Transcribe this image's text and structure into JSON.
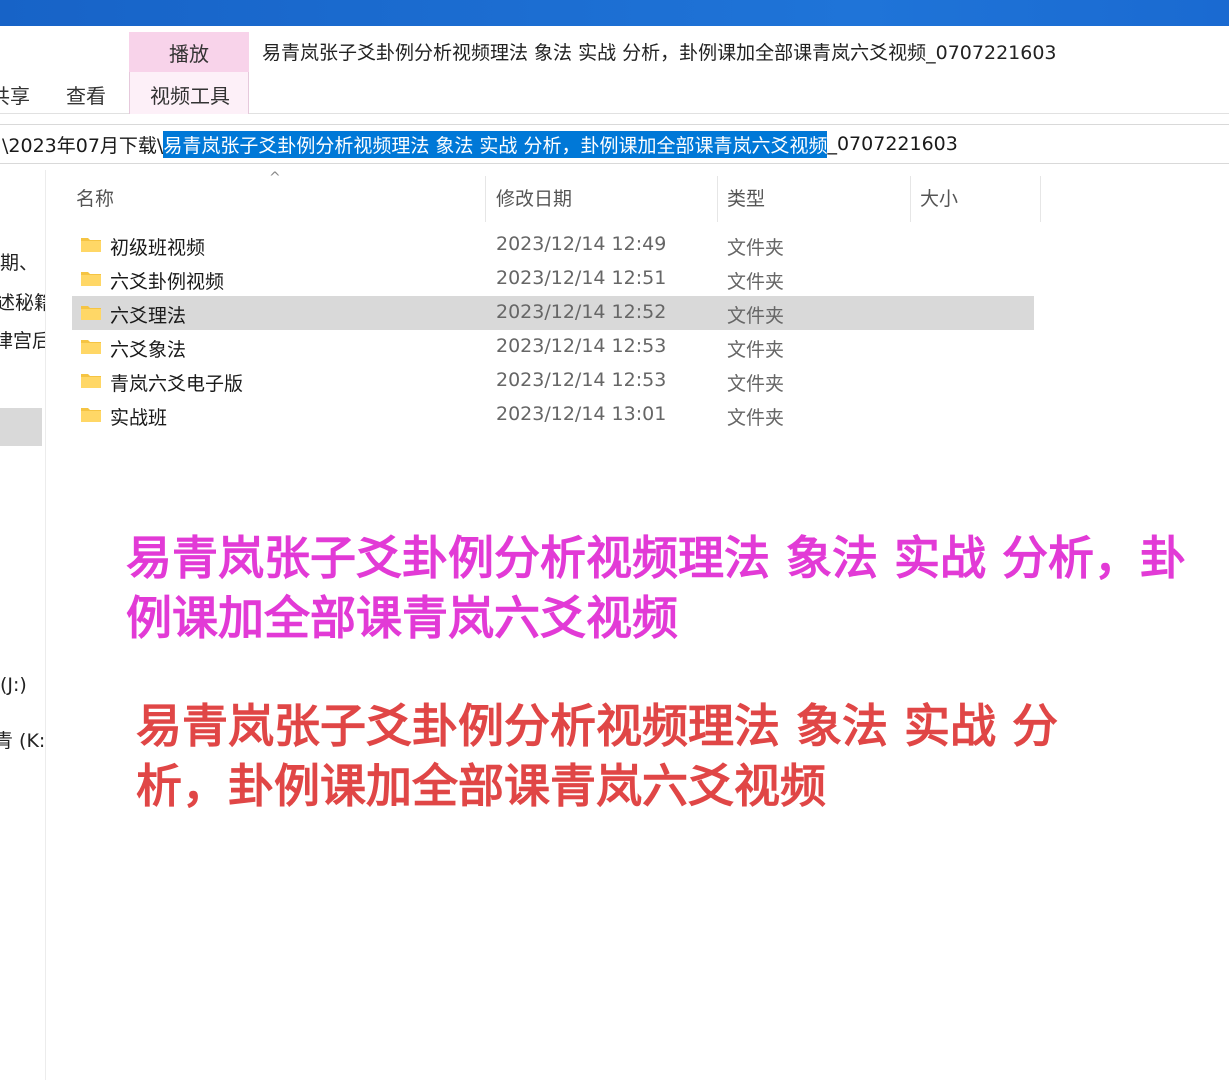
{
  "window_title": "易青岚张子爻卦例分析视频理法  象法  实战   分析，卦例课加全部课青岚六爻视频_0707221603",
  "ribbon": {
    "context_header": "播放",
    "tabs": [
      {
        "label": "共享"
      },
      {
        "label": "查看"
      },
      {
        "label": "视频工具"
      }
    ]
  },
  "address": {
    "prefix": "\\2023年07月下载\\",
    "selected_text": "易青岚张子爻卦例分析视频理法  象法  实战   分析，卦例课加全部课青岚六爻视频",
    "suffix": "_0707221603"
  },
  "nav_pane": {
    "items": [
      "期、",
      "述秘籍",
      "律宫后",
      "(J:)",
      "青 (K:)"
    ]
  },
  "columns": {
    "name": "名称",
    "modified": "修改日期",
    "type": "类型",
    "size": "大小"
  },
  "files": [
    {
      "name": "初级班视频",
      "modified": "2023/12/14 12:49",
      "type": "文件夹",
      "selected": false
    },
    {
      "name": "六爻卦例视频",
      "modified": "2023/12/14 12:51",
      "type": "文件夹",
      "selected": false
    },
    {
      "name": "六爻理法",
      "modified": "2023/12/14 12:52",
      "type": "文件夹",
      "selected": true
    },
    {
      "name": "六爻象法",
      "modified": "2023/12/14 12:53",
      "type": "文件夹",
      "selected": false
    },
    {
      "name": "青岚六爻电子版",
      "modified": "2023/12/14 12:53",
      "type": "文件夹",
      "selected": false
    },
    {
      "name": "实战班",
      "modified": "2023/12/14 13:01",
      "type": "文件夹",
      "selected": false
    }
  ],
  "overlay_text": {
    "magenta": "易青岚张子爻卦例分析视频理法  象法  实战   分析，卦例课加全部课青岚六爻视频",
    "red": "易青岚张子爻卦例分析视频理法  象法  实战   分析，卦例课加全部课青岚六爻视频"
  },
  "colors": {
    "titlebar": "#1f74d8",
    "context_tab": "#f8d3ea",
    "selection": "#0078d7",
    "row_selected": "#d9d9d9",
    "overlay_magenta": "#e23ad6",
    "overlay_red": "#e04646"
  }
}
